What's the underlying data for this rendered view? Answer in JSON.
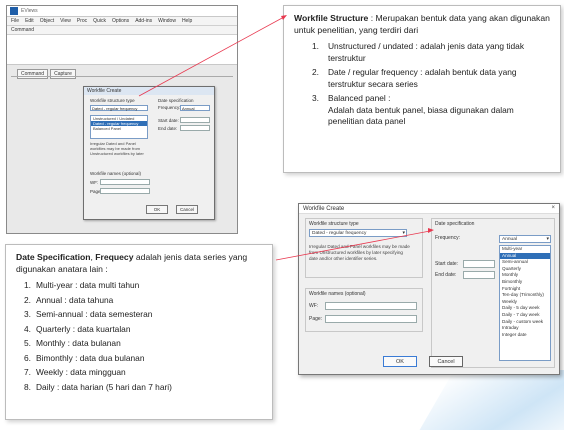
{
  "colors": {
    "arrow": "#e8384f",
    "selection": "#2f6fb7",
    "accent_blue": "#1f5ea8"
  },
  "app": {
    "title": "EViews",
    "menu": [
      "File",
      "Edit",
      "Object",
      "View",
      "Proc",
      "Quick",
      "Options",
      "Add-ins",
      "Window",
      "Help"
    ],
    "command_label": "Command",
    "tabs": [
      "Command",
      "Capture"
    ]
  },
  "small_dialog": {
    "title": "Workfile Create",
    "structure_label": "Workfile structure type",
    "structure_value": "Dated - regular frequency",
    "structure_options": [
      "Unstructured / Undated",
      "Dated - regular frequency",
      "Balanced Panel"
    ],
    "description": "Irregular Dated and Panel workfiles may be made from Unstructured workfiles by later specifying date and/or other identifier series.",
    "date_spec_label": "Date specification",
    "frequency_label": "Frequency:",
    "frequency_value": "Annual",
    "start_label": "Start date:",
    "end_label": "End date:",
    "names_label": "Workfile names (optional)",
    "wf_label": "WF:",
    "page_label": "Page:",
    "ok": "OK",
    "cancel": "Cancel"
  },
  "callout_structure": {
    "title": "Workfile Structure",
    "intro": " : Merupakan bentuk data yang akan digunakan untuk penelitian, yang terdiri dari",
    "items": [
      {
        "num": "1.",
        "text": "Unstructured / undated : adalah jenis data yang tidak terstruktur"
      },
      {
        "num": "2.",
        "text": "Date / regular frequency : adalah bentuk data yang terstruktur secara series"
      },
      {
        "num": "3.",
        "text": "Balanced panel :",
        "detail": "Adalah data bentuk panel, biasa digunakan dalam penelitian data panel"
      }
    ]
  },
  "callout_date": {
    "title_a": "Date Specification",
    "sep": ", ",
    "title_b": "Frequecy",
    "intro": " adalah jenis data series yang digunakan anatara lain :",
    "items": [
      {
        "num": "1.",
        "text": "Multi-year : data multi tahun"
      },
      {
        "num": "2.",
        "text": "Annual : data tahuna"
      },
      {
        "num": "3.",
        "text": "Semi-annual : data semesteran"
      },
      {
        "num": "4.",
        "text": "Quarterly : data kuartalan"
      },
      {
        "num": "5.",
        "text": "Monthly : data bulanan"
      },
      {
        "num": "6.",
        "text": "Bimonthly : data dua bulanan"
      },
      {
        "num": "7.",
        "text": "Weekly : data mingguan"
      },
      {
        "num": "8.",
        "text": "Daily : data harian (5 hari dan 7 hari)"
      }
    ]
  },
  "big_dialog": {
    "title": "Workfile Create",
    "close": "×",
    "structure_label": "Workfile structure type",
    "structure_value": "Dated - regular frequency",
    "description": "Irregular Dated and Panel workfiles may be made from Unstructured workfiles by later specifying date and/or other identifier series.",
    "date_spec_label": "Date specification",
    "frequency_label": "Frequency:",
    "frequency_value": "Annual",
    "start_label": "Start date:",
    "end_label": "End date:",
    "frequency_options": [
      "Multi-year",
      "Annual",
      "Semi-annual",
      "Quarterly",
      "Monthly",
      "Bimonthly",
      "Fortnight",
      "Ten-day (Trimonthly)",
      "Weekly",
      "Daily - 5 day week",
      "Daily - 7 day week",
      "Daily - custom week",
      "Intraday",
      "Integer date"
    ],
    "selected_frequency_index": 1,
    "names_label": "Workfile names (optional)",
    "wf_label": "WF:",
    "page_label": "Page:",
    "ok": "OK",
    "cancel": "Cancel"
  }
}
